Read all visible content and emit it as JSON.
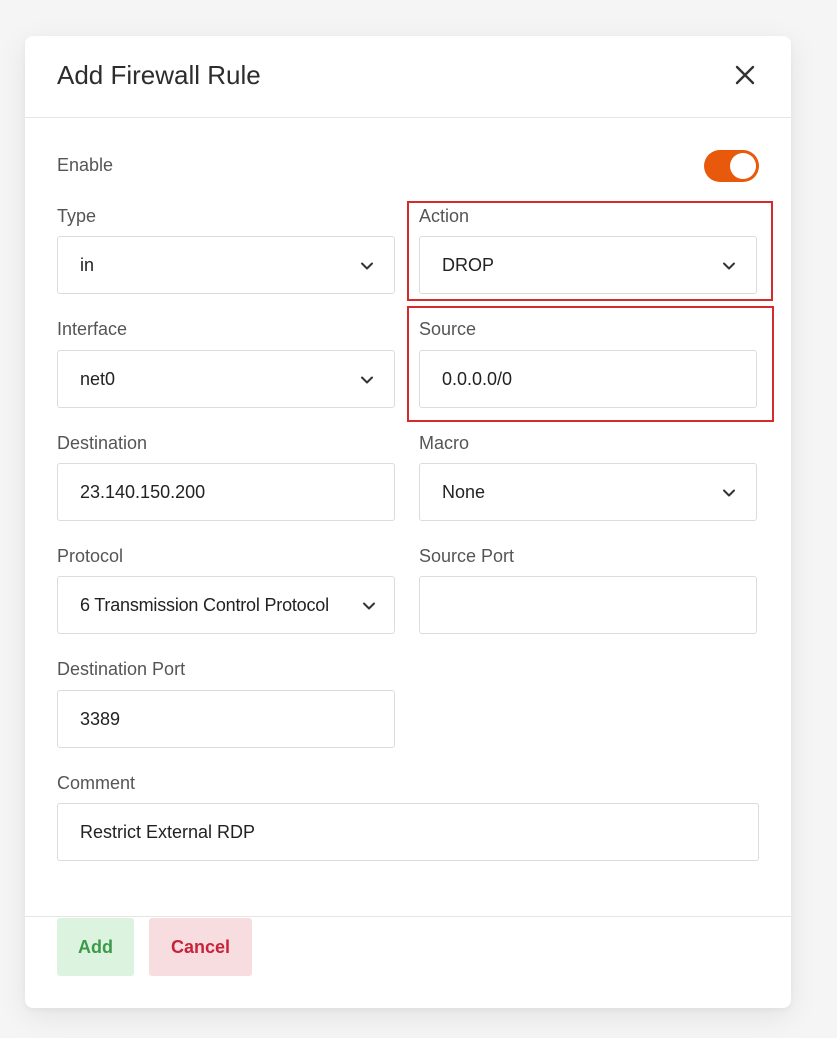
{
  "dialog": {
    "title": "Add Firewall Rule"
  },
  "enable": {
    "label": "Enable",
    "on": true
  },
  "fields": {
    "type": {
      "label": "Type",
      "value": "in"
    },
    "action": {
      "label": "Action",
      "value": "DROP"
    },
    "interface": {
      "label": "Interface",
      "value": "net0"
    },
    "source": {
      "label": "Source",
      "value": "0.0.0.0/0"
    },
    "destination": {
      "label": "Destination",
      "value": "23.140.150.200"
    },
    "macro": {
      "label": "Macro",
      "value": "None"
    },
    "protocol": {
      "label": "Protocol",
      "value": "6 Transmission Control Protocol"
    },
    "source_port": {
      "label": "Source Port",
      "value": ""
    },
    "destination_port": {
      "label": "Destination Port",
      "value": "3389"
    },
    "comment": {
      "label": "Comment",
      "value": "Restrict External RDP"
    }
  },
  "buttons": {
    "add": "Add",
    "cancel": "Cancel"
  },
  "icons": {
    "close": "close-icon",
    "dropdown": "chevron-down-icon"
  },
  "colors": {
    "toggle_on": "#e8590c",
    "highlight": "#d62b2b",
    "add_bg": "#dcf3e0",
    "add_text": "#3c9a4a",
    "cancel_bg": "#f8dde0",
    "cancel_text": "#c8233a"
  }
}
